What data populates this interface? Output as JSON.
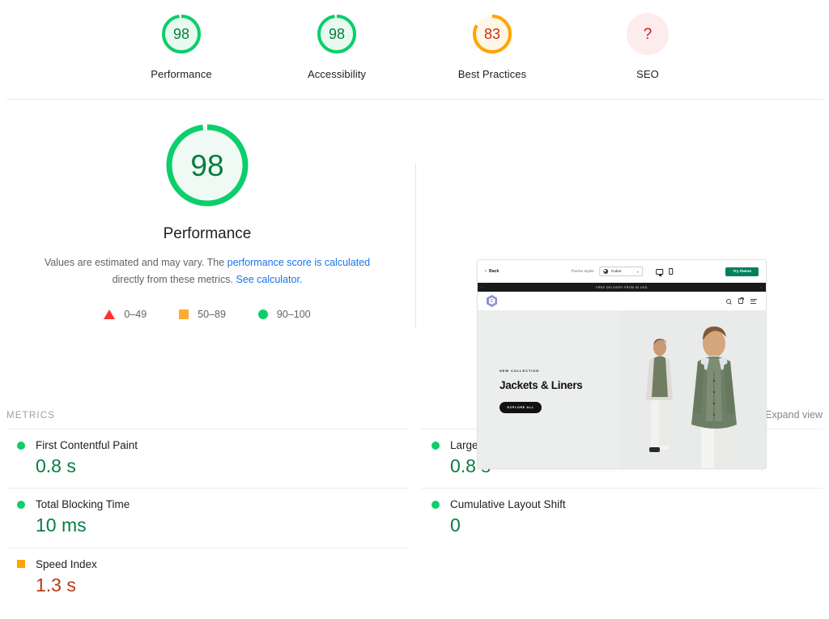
{
  "category_scores": [
    {
      "name": "performance",
      "score": "98",
      "label": "Performance",
      "state": "pass",
      "pct": 98
    },
    {
      "name": "accessibility",
      "score": "98",
      "label": "Accessibility",
      "state": "pass",
      "pct": 98
    },
    {
      "name": "best-practices",
      "score": "83",
      "label": "Best Practices",
      "state": "average",
      "pct": 83
    },
    {
      "name": "seo",
      "score": "?",
      "label": "SEO",
      "state": "error",
      "pct": 0
    }
  ],
  "performance_panel": {
    "score": "98",
    "pct": 98,
    "title": "Performance",
    "disclaimer_part1": "Values are estimated and may vary. The ",
    "disclaimer_link1": "performance score is calculated",
    "disclaimer_part2": " directly from these metrics. ",
    "disclaimer_link2": "See calculator.",
    "legend": [
      {
        "icon": "red-triangle-icon",
        "range": "0–49"
      },
      {
        "icon": "orange-square-icon",
        "range": "50–89"
      },
      {
        "icon": "green-circle-icon",
        "range": "90–100"
      }
    ]
  },
  "thumbnail": {
    "back_label": "Back",
    "theme_styles_label": "Theme styles",
    "theme_style_value": "Cubor",
    "try_theme_label": "Try theme",
    "announcement": "FREE DELIVERY FROM 50 USD",
    "logo_letter": "C",
    "hero_eyebrow": "NEW COLLECTION",
    "hero_heading": "Jackets & Liners",
    "hero_cta": "EXPLORE ALL"
  },
  "metrics": {
    "section_title": "METRICS",
    "expand_view": "Expand view",
    "left_column": [
      {
        "name": "First Contentful Paint",
        "value": "0.8 s",
        "state": "pass",
        "value_color": "#0a7c42"
      },
      {
        "name": "Total Blocking Time",
        "value": "10 ms",
        "state": "pass",
        "value_color": "#0a7c42"
      },
      {
        "name": "Speed Index",
        "value": "1.3 s",
        "state": "average",
        "value_color": "#b93b12"
      }
    ],
    "right_column": [
      {
        "name": "Largest Contentful Paint",
        "value": "0.8 s",
        "state": "pass",
        "value_color": "#0a7c42"
      },
      {
        "name": "Cumulative Layout Shift",
        "value": "0",
        "state": "pass",
        "value_color": "#0a7c42"
      }
    ]
  },
  "colors": {
    "pass": "#0cce6b",
    "average": "#ffa400",
    "fail": "#ff3333",
    "link": "#1a73e8",
    "pass_text": "#0a7c42",
    "average_text": "#b93b12",
    "error_text": "#c7221f",
    "brand_teal": "#008060"
  }
}
